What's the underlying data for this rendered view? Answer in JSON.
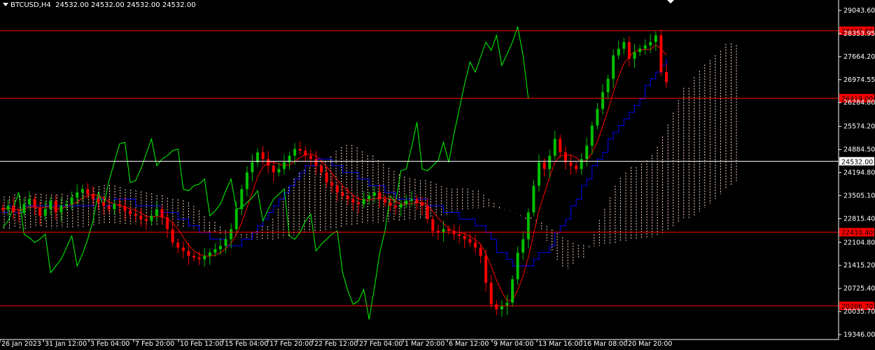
{
  "header": {
    "symbol": "BTCUSD,H4",
    "ohlc": "24532.00 24532.00 24532.00 24532.00"
  },
  "colors": {
    "background": "#000000",
    "bull": "#00c000",
    "bear": "#ff0000",
    "tenkan": "#ff0000",
    "kijun": "#0000ff",
    "chikou": "#00ff00",
    "cloud": "#ffd8c0",
    "level_line": "#ff0000",
    "current_line": "#ffffff",
    "axis_text": "#ffffff"
  },
  "chart_data": {
    "type": "candlestick",
    "y_ticks": [
      "29043.60",
      "28353.95",
      "27664.20",
      "26974.55",
      "26284.80",
      "25574.20",
      "24884.50",
      "24194.80",
      "23505.10",
      "22815.40",
      "22104.80",
      "21415.20",
      "20725.40",
      "20035.70",
      "19346.00"
    ],
    "y_values": [
      29043.6,
      28353.95,
      27664.2,
      26974.55,
      26284.8,
      25574.2,
      24884.5,
      24194.8,
      23505.1,
      22815.4,
      22104.8,
      21415.2,
      20725.4,
      20035.7,
      19346.0
    ],
    "x_labels": [
      "26 Jan 2023",
      "31 Jan 12:00",
      "3 Feb 04:00",
      "7 Feb 20:00",
      "10 Feb 12:00",
      "15 Feb 04:00",
      "17 Feb 20:00",
      "22 Feb 12:00",
      "27 Feb 04:00",
      "1 Mar 20:00",
      "6 Mar 12:00",
      "9 Mar 04:00",
      "13 Mar 16:00",
      "16 Mar 08:00",
      "20 Mar 20:00"
    ],
    "ylim": [
      19346.0,
      29043.6
    ],
    "levels": [
      {
        "label": "28437.80",
        "value": 28437.8
      },
      {
        "label": "26419.00",
        "value": 26419.0
      },
      {
        "label": "22410.40",
        "value": 22410.4
      },
      {
        "label": "20206.70",
        "value": 20206.7
      }
    ],
    "current": {
      "label": "24532.00",
      "value": 24532.0
    },
    "candle_closes": [
      23080,
      23200,
      23010,
      22980,
      23250,
      23400,
      23150,
      22900,
      23100,
      23350,
      23000,
      23200,
      23250,
      23450,
      23600,
      23700,
      23550,
      23400,
      23300,
      23200,
      23100,
      23250,
      23200,
      23050,
      22950,
      22900,
      22800,
      22750,
      22900,
      23100,
      22850,
      22500,
      22100,
      21950,
      21850,
      21700,
      21650,
      21600,
      21700,
      21800,
      21900,
      22000,
      22200,
      22500,
      23100,
      23700,
      24200,
      24500,
      24800,
      24600,
      24400,
      24200,
      24300,
      24500,
      24700,
      24900,
      24850,
      24700,
      24600,
      24400,
      24200,
      23900,
      23800,
      23600,
      23500,
      23400,
      23300,
      23250,
      23400,
      23500,
      23600,
      23400,
      23300,
      23200,
      23150,
      23250,
      23350,
      23400,
      23300,
      23200,
      22800,
      22450,
      22400,
      22500,
      22450,
      22350,
      22300,
      22200,
      22100,
      21950,
      21700,
      20900,
      20250,
      20100,
      20200,
      20300,
      21000,
      21800,
      22200,
      23000,
      23800,
      24500,
      24300,
      24700,
      25200,
      24800,
      24500,
      24400,
      24300,
      24600,
      25000,
      25600,
      26100,
      26600,
      27000,
      27700,
      27900,
      28100,
      27600,
      27800,
      27900,
      28000,
      28100,
      28300,
      27200,
      26900
    ]
  }
}
